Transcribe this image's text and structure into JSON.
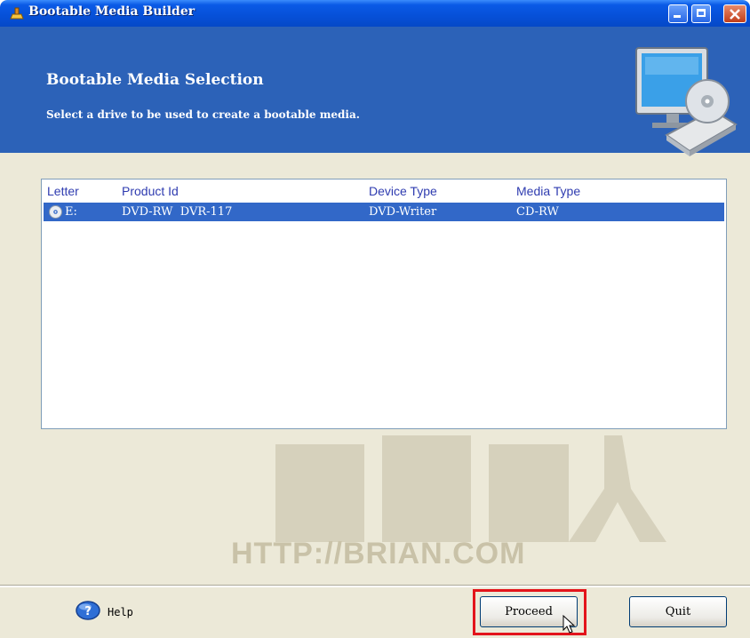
{
  "window": {
    "title": "Bootable Media Builder"
  },
  "header": {
    "title": "Bootable Media Selection",
    "subtitle": "Select a drive to be used to create a bootable media.",
    "image_icon": "monitor-with-disc-icon"
  },
  "list": {
    "columns": [
      "Letter",
      "Product Id",
      "Device Type",
      "Media Type"
    ],
    "rows": [
      {
        "letter": "E:",
        "product_id": "DVD-RW  DVR-117",
        "device_type": "DVD-Writer",
        "media_type": "CD-RW",
        "icon": "optical-disc-icon",
        "selected": true
      }
    ]
  },
  "watermark": {
    "url_text": "HTTP://BRIAN.COM"
  },
  "footer": {
    "help_label": "Help",
    "proceed_label": "Proceed",
    "quit_label": "Quit"
  },
  "colors": {
    "titlebar": "#0650d8",
    "header_bg": "#2c62b8",
    "selection": "#3268c8",
    "highlight_box": "#e3141b",
    "column_header_text": "#2f3cb0"
  }
}
